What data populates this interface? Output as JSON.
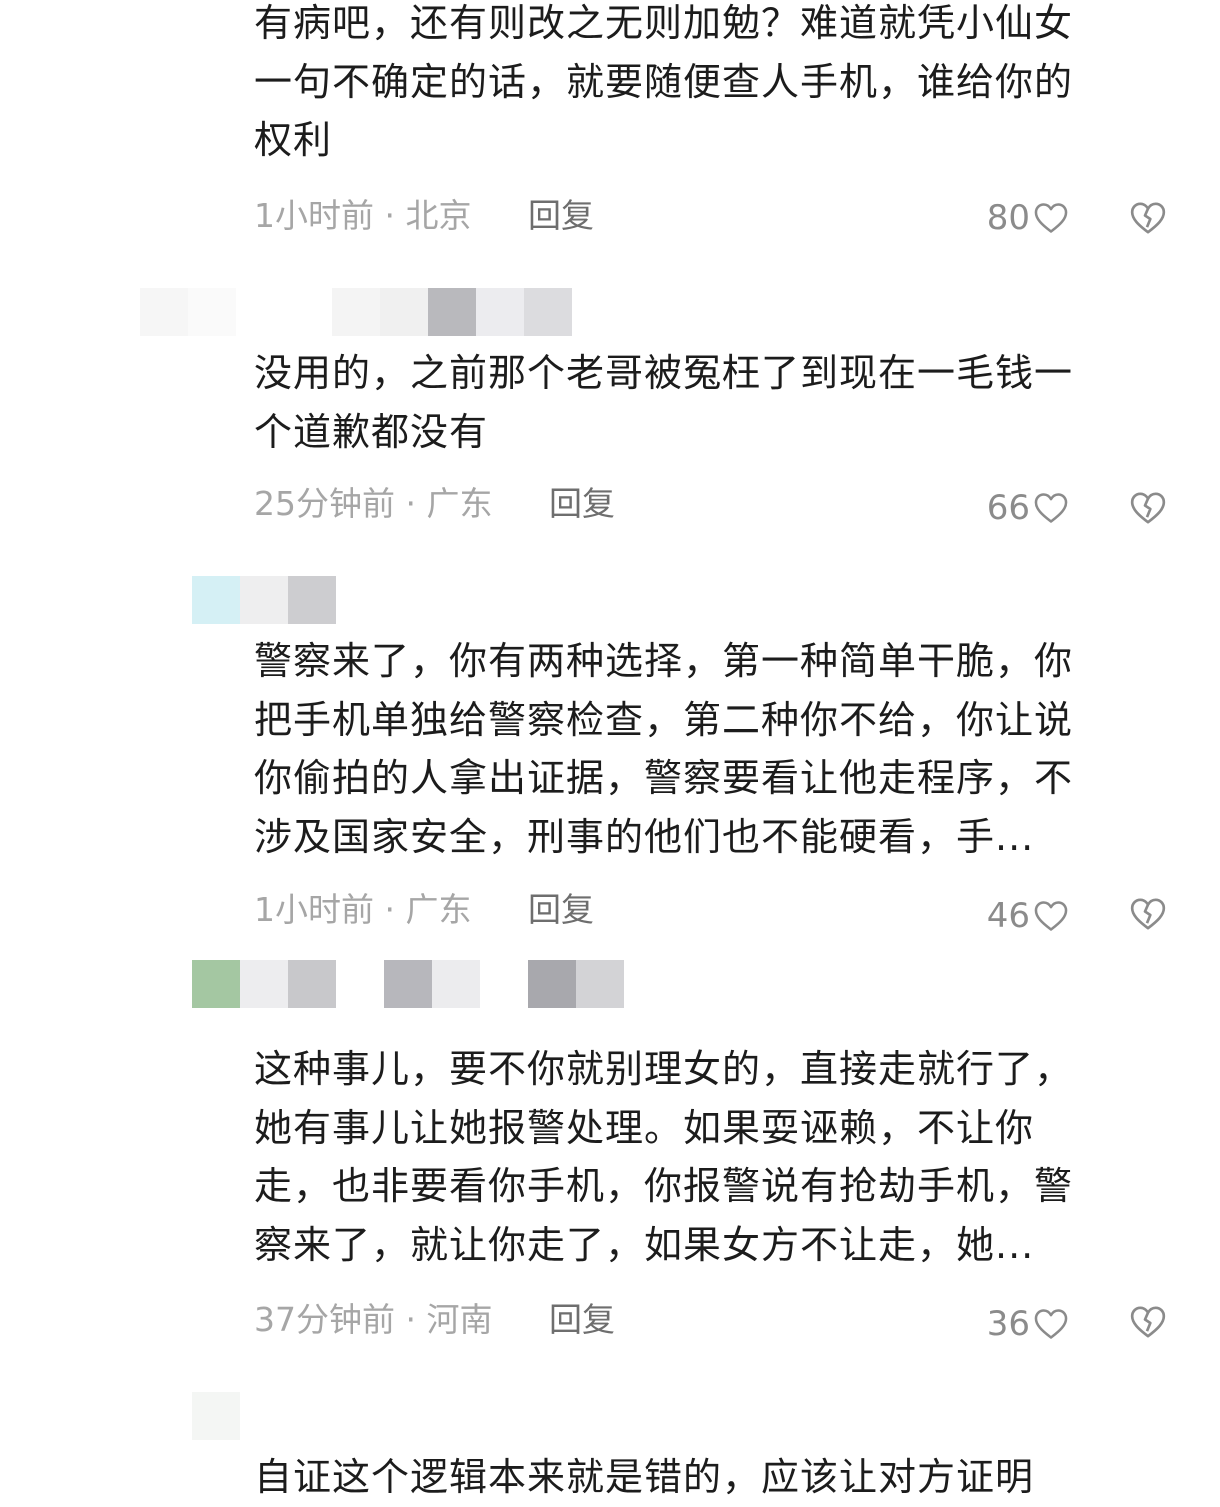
{
  "comments": [
    {
      "text": "有病吧，还有则改之无则加勉？难道就凭小仙女\n一句不确定的话，就要随便查人手机，谁给你的\n权利",
      "time_location": "1小时前 · 北京",
      "reply": "回复",
      "likes": "80"
    },
    {
      "text": "没用的，之前那个老哥被冤枉了到现在一毛钱一\n个道歉都没有",
      "time_location": "25分钟前 · 广东",
      "reply": "回复",
      "likes": "66"
    },
    {
      "text": "警察来了，你有两种选择，第一种简单干脆，你\n把手机单独给警察检查，第二种你不给，你让说\n你偷拍的人拿出证据，警察要看让他走程序，不\n涉及国家安全，刑事的他们也不能硬看，手...",
      "time_location": "1小时前 · 广东",
      "reply": "回复",
      "likes": "46"
    },
    {
      "text": "这种事儿，要不你就别理女的，直接走就行了，\n她有事儿让她报警处理。如果耍诬赖，不让你\n走，也非要看你手机，你报警说有抢劫手机，警\n察来了，就让你走了，如果女方不让走，她...",
      "time_location": "37分钟前 · 河南",
      "reply": "回复",
      "likes": "36"
    },
    {
      "text": "自证这个逻辑本来就是错的，应该让对方证明"
    }
  ]
}
